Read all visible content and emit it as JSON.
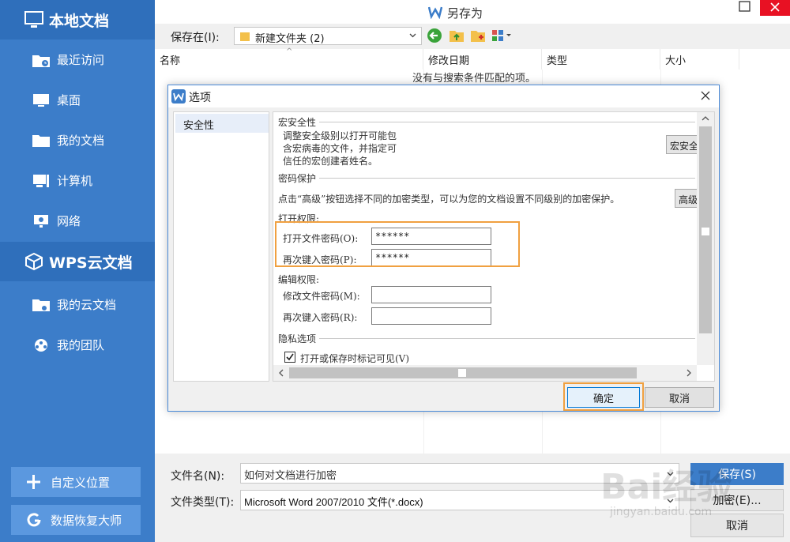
{
  "sidebar": {
    "local_title": "本地文档",
    "local_items": [
      {
        "label": "最近访问",
        "icon": "recent-folder-icon"
      },
      {
        "label": "桌面",
        "icon": "desktop-icon"
      },
      {
        "label": "我的文档",
        "icon": "documents-folder-icon"
      },
      {
        "label": "计算机",
        "icon": "computer-icon"
      },
      {
        "label": "网络",
        "icon": "network-icon"
      }
    ],
    "cloud_title": "WPS云文档",
    "cloud_items": [
      {
        "label": "我的云文档",
        "icon": "cloud-folder-icon"
      },
      {
        "label": "我的团队",
        "icon": "team-icon"
      }
    ],
    "custom_location_label": "自定义位置",
    "recovery_label": "数据恢复大师"
  },
  "dialog": {
    "title": "另存为",
    "save_in_label": "保存在(I):",
    "save_in_value": "新建文件夹 (2)",
    "columns": [
      "名称",
      "修改日期",
      "类型",
      "大小"
    ],
    "empty_message": "没有与搜索条件匹配的项。",
    "filename_label": "文件名(N):",
    "filename_value": "如何对文档进行加密",
    "filetype_label": "文件类型(T):",
    "filetype_value": "Microsoft Word 2007/2010 文件(*.docx)",
    "save_button": "保存(S)",
    "encrypt_button": "加密(E)...",
    "cancel_button": "取消"
  },
  "options": {
    "title": "选项",
    "nav_items": [
      "安全性"
    ],
    "macro_section": "宏安全性",
    "macro_desc": [
      "调整安全级别以打开可能包",
      "含宏病毒的文件，并指定可",
      "信任的宏创建者姓名。"
    ],
    "macro_button": "宏安全",
    "password_section": "密码保护",
    "password_desc": "点击“高级”按钮选择不同的加密类型，可以为您的文档设置不同级别的加密保护。",
    "advanced_button": "高级",
    "open_perm_section": "打开权限:",
    "open_pwd_label": "打开文件密码(O):",
    "open_pwd_value": "******",
    "open_pwd_confirm_label": "再次键入密码(P):",
    "open_pwd_confirm_value": "******",
    "edit_perm_section": "编辑权限:",
    "edit_pwd_label": "修改文件密码(M):",
    "edit_pwd_value": "",
    "edit_pwd_confirm_label": "再次键入密码(R):",
    "edit_pwd_confirm_value": "",
    "privacy_section": "隐私选项",
    "privacy_checkbox_label": "打开或保存时标记可见(V)",
    "privacy_checked": true,
    "ok_button": "确定",
    "cancel_button": "取消"
  },
  "watermark": {
    "text": "Bai经验",
    "sub": "jingyan.baidu.com"
  },
  "colors": {
    "sidebar": "#3c7dc9",
    "sidebar_header": "#2f6fbb",
    "accent": "#3c7dc9",
    "highlight": "#f0a040",
    "close_red": "#e81123"
  }
}
